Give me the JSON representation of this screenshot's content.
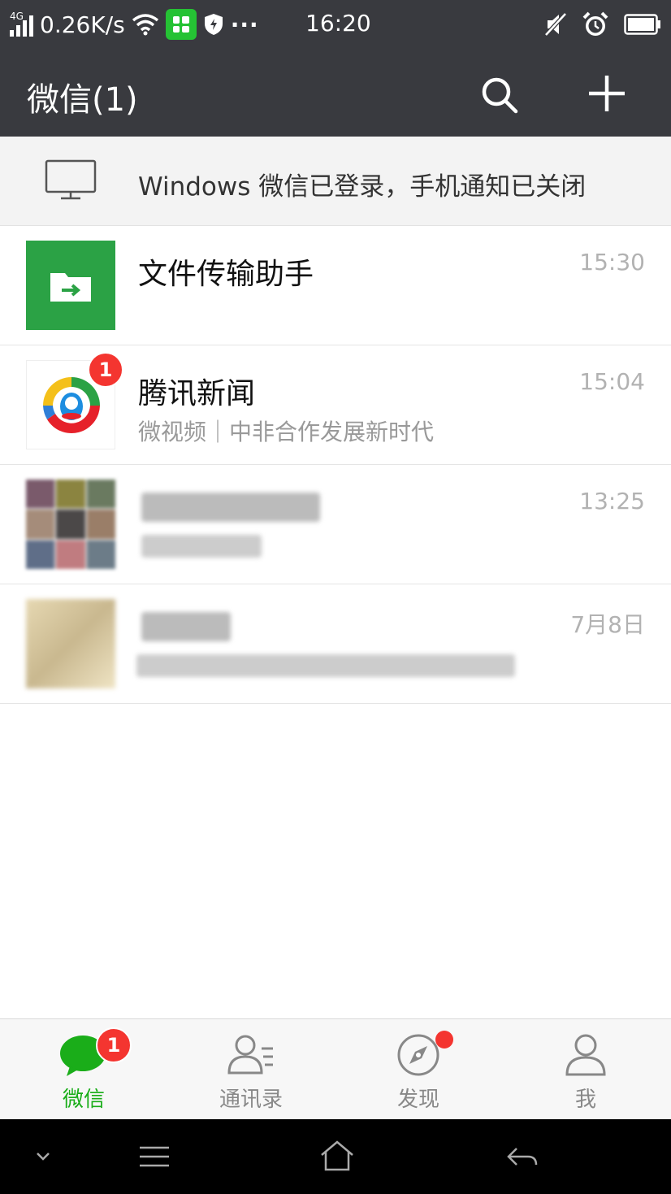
{
  "status_bar": {
    "network": "4G",
    "speed": "0.26K/s",
    "more": "···",
    "time": "16:20"
  },
  "header": {
    "title": "微信(1)"
  },
  "banner": {
    "text": "Windows 微信已登录，手机通知已关闭"
  },
  "chats": [
    {
      "name": "文件传输助手",
      "preview": "",
      "time": "15:30",
      "badge": ""
    },
    {
      "name": "腾讯新闻",
      "preview": "微视频｜中非合作发展新时代",
      "time": "15:04",
      "badge": "1"
    },
    {
      "name": "",
      "preview": "",
      "time": "13:25",
      "badge": ""
    },
    {
      "name": "",
      "preview": "",
      "time": "7月8日",
      "badge": ""
    }
  ],
  "tabs": [
    {
      "label": "微信",
      "badge": "1"
    },
    {
      "label": "通讯录"
    },
    {
      "label": "发现"
    },
    {
      "label": "我"
    }
  ],
  "colors": {
    "header_bg": "#393a3f",
    "accent_green": "#1aad19",
    "badge_red": "#f43530",
    "file_helper_green": "#2ba245"
  },
  "icons": [
    "signal-icon",
    "wifi-icon",
    "shield-icon",
    "mute-icon",
    "alarm-icon",
    "battery-icon",
    "search-icon",
    "plus-icon",
    "monitor-icon",
    "folder-arrow-icon",
    "tencent-news-icon",
    "chat-bubble-icon",
    "contacts-icon",
    "compass-icon",
    "person-icon"
  ]
}
